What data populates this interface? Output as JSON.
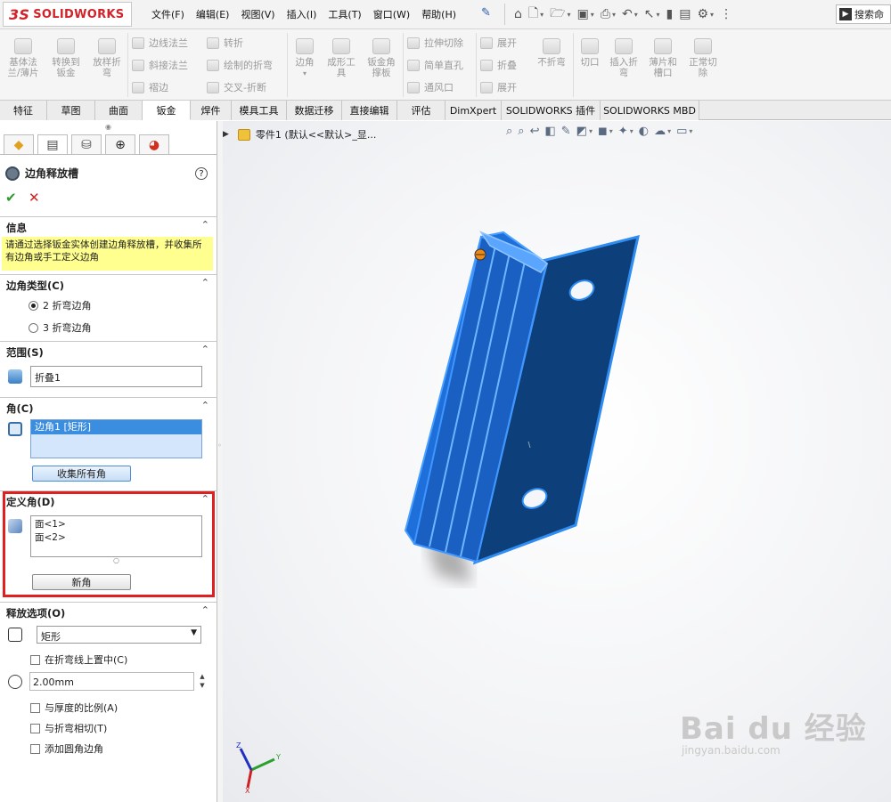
{
  "app": {
    "logo_text": "SOLIDWORKS",
    "logo_mark": "3S"
  },
  "menu": [
    "文件(F)",
    "编辑(E)",
    "视图(V)",
    "插入(I)",
    "工具(T)",
    "窗口(W)",
    "帮助(H)"
  ],
  "search": {
    "placeholder": "搜索命"
  },
  "ribbon": {
    "large": [
      {
        "label": "基体法\n兰/薄片"
      },
      {
        "label": "转换到\n钣金"
      },
      {
        "label": "放样折\n弯"
      },
      {
        "label": "边角"
      },
      {
        "label": "成形工\n具"
      },
      {
        "label": "钣金角\n撑板"
      },
      {
        "label": "不折弯"
      },
      {
        "label": "切口"
      },
      {
        "label": "插入折\n弯"
      },
      {
        "label": "薄片和\n槽口"
      },
      {
        "label": "正常切\n除"
      }
    ],
    "small": [
      "边线法兰",
      "斜接法兰",
      "褶边",
      "转折",
      "绘制的折弯",
      "交叉-折断",
      "拉伸切除",
      "简单直孔",
      "通风口",
      "展开",
      "折叠",
      "展开"
    ]
  },
  "tabs": [
    "特征",
    "草图",
    "曲面",
    "钣金",
    "焊件",
    "模具工具",
    "数据迁移",
    "直接编辑",
    "评估",
    "DimXpert",
    "SOLIDWORKS 插件",
    "SOLIDWORKS MBD"
  ],
  "active_tab": "钣金",
  "panel": {
    "title": "边角释放槽",
    "help": "?",
    "info": {
      "title": "信息",
      "text": "请通过选择钣金实体创建边角释放槽，并收集所有边角或手工定义边角"
    },
    "corner_type": {
      "title": "边角类型(C)",
      "options": [
        "2 折弯边角",
        "3 折弯边角"
      ],
      "selected": "2 折弯边角"
    },
    "scope": {
      "title": "范围(S)",
      "value": "折叠1"
    },
    "corners": {
      "title": "角(C)",
      "items": [
        "边角1 [矩形]"
      ],
      "collect_button": "收集所有角"
    },
    "define": {
      "title": "定义角(D)",
      "faces": [
        "面<1>",
        "面<2>"
      ],
      "new_button": "新角"
    },
    "relief": {
      "title": "释放选项(O)",
      "type": "矩形",
      "center_on_bend": "在折弯线上置中(C)",
      "size": "2.00mm",
      "ratio_to_thickness": "与厚度的比例(A)",
      "tangent_to_bend": "与折弯相切(T)",
      "add_fillet": "添加圆角边角"
    }
  },
  "viewport": {
    "tree_label": "零件1  (默认<<默认>_显...",
    "triad": {
      "x": "X",
      "y": "Y",
      "z": "Z"
    }
  },
  "watermark": {
    "main": "Bai du 经验",
    "sub": "jingyan.baidu.com"
  },
  "colors": {
    "part_blue": "#1e6fd9",
    "part_dark": "#0d3f7a",
    "highlight_red": "#e02020",
    "info_yellow": "#ffff90"
  }
}
